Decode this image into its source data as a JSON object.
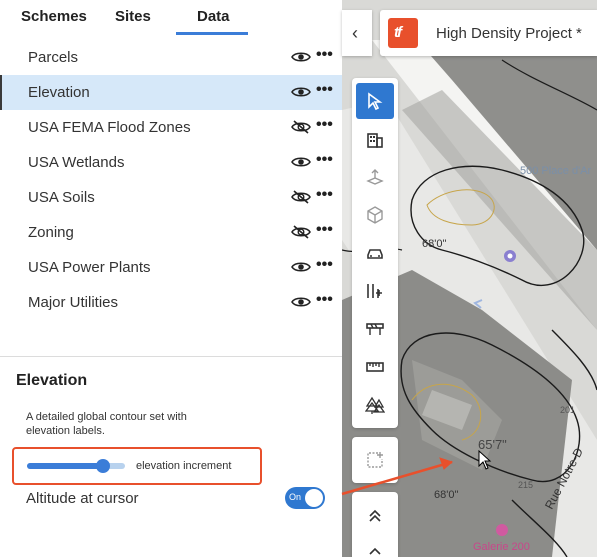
{
  "tabs": [
    {
      "label": "Schemes"
    },
    {
      "label": "Sites"
    },
    {
      "label": "Data",
      "active": true
    }
  ],
  "layers": [
    {
      "label": "Parcels",
      "visible": true
    },
    {
      "label": "Elevation",
      "visible": true,
      "selected": true
    },
    {
      "label": "USA FEMA Flood Zones",
      "visible": false
    },
    {
      "label": "USA Wetlands",
      "visible": true
    },
    {
      "label": "USA Soils",
      "visible": false
    },
    {
      "label": "Zoning",
      "visible": false
    },
    {
      "label": "USA Power Plants",
      "visible": true
    },
    {
      "label": "Major Utilities",
      "visible": true
    }
  ],
  "detail": {
    "title": "Elevation",
    "description": "A detailed global contour set with elevation labels.",
    "slider_label": "elevation increment",
    "slider_value": 0.78,
    "altitude_label": "Altitude at cursor",
    "toggle_text": "On",
    "toggle_on": true
  },
  "header": {
    "logo_text": "tf",
    "project_title": "High Density Project *",
    "collapse_icon": "chevron-left-icon"
  },
  "map": {
    "labels": {
      "elev_a": "68'0\"",
      "elev_b": "68'0\"",
      "cursor_elev": "65'7\"",
      "place": "500 Place d'Ar",
      "rue": "Rue Notre-D",
      "galerie": "Galerie 200",
      "n201": "201",
      "n215": "215"
    }
  },
  "toolbar": {
    "tools": [
      "select-icon",
      "building-icon",
      "extrude-icon",
      "3d-box-icon",
      "car-icon",
      "add-columns-icon",
      "barrier-icon",
      "ruler-icon",
      "tree-icon"
    ],
    "extra": [
      "add-frame-icon",
      "double-chevron-up-icon",
      "chevron-up-icon"
    ]
  },
  "colors": {
    "accent": "#2f78d0",
    "highlight": "#e8502c",
    "selected_row": "#d6e8f9"
  }
}
